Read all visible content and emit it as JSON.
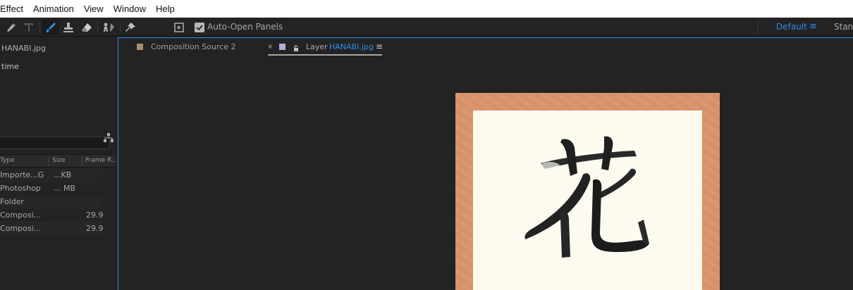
{
  "menu": {
    "items": [
      {
        "label": "Effect",
        "name": "menu-effect"
      },
      {
        "label": "Animation",
        "name": "menu-animation"
      },
      {
        "label": "View",
        "name": "menu-view"
      },
      {
        "label": "Window",
        "name": "menu-window"
      },
      {
        "label": "Help",
        "name": "menu-help"
      }
    ]
  },
  "toolbar": {
    "auto_open_label": "Auto-Open Panels",
    "auto_open_checked": true,
    "workspace_default": "Default",
    "workspace_menu_glyph": "≡",
    "workspace_standard": "Stand",
    "tools": [
      "pen-icon",
      "type-icon",
      "brush-icon",
      "clone-stamp-icon",
      "eraser-icon",
      "roto-brush-icon",
      "puppet-pin-icon",
      "snap-icon"
    ]
  },
  "project": {
    "selected_name": "HANABI.jpg",
    "info_line": "time",
    "columns": [
      "Type",
      "Size",
      "Frame R..."
    ],
    "rows": [
      {
        "type": "Importe...G",
        "size": "...KB",
        "frame": ""
      },
      {
        "type": "Photoshop",
        "size": "... MB",
        "frame": ""
      },
      {
        "type": "Folder",
        "size": "",
        "frame": ""
      },
      {
        "type": "Composi...",
        "size": "",
        "frame": "29.9"
      },
      {
        "type": "Composi...",
        "size": "",
        "frame": "29.9"
      }
    ]
  },
  "viewer": {
    "tabs": [
      {
        "label": "Composition Source 2",
        "color": "#a88f6f"
      },
      {
        "label": "Layer",
        "file": "HANABI.jpg",
        "color": "#b5a9d6",
        "close": "×",
        "menu": "≡"
      }
    ]
  },
  "colors": {
    "accent": "#2d8ceb",
    "panel_bg": "#232323",
    "frame": "#d9956d",
    "paper": "#fdfbf0"
  }
}
